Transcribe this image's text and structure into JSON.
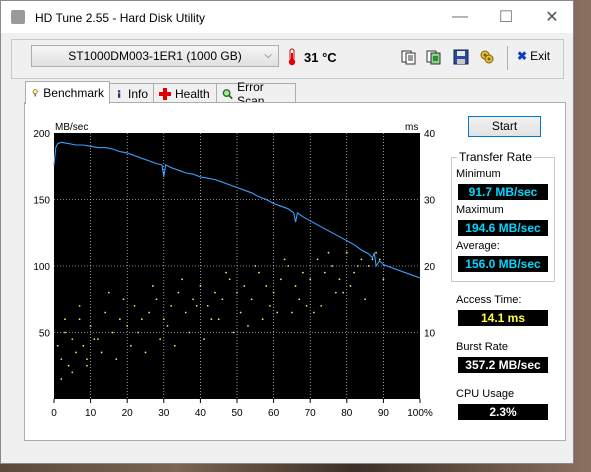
{
  "window": {
    "title": "HD Tune 2.55 - Hard Disk Utility"
  },
  "toolbar": {
    "drive": "ST1000DM003-1ER1 (1000 GB)",
    "temperature": "31 °C",
    "exit_label": "Exit",
    "icons": [
      "copy-text-icon",
      "copy-image-icon",
      "save-icon",
      "options-icon"
    ]
  },
  "tabs": [
    {
      "label": "Benchmark",
      "icon": "benchmark-icon",
      "active": true
    },
    {
      "label": "Info",
      "icon": "info-icon",
      "active": false
    },
    {
      "label": "Health",
      "icon": "health-icon",
      "active": false
    },
    {
      "label": "Error Scan",
      "icon": "error-scan-icon",
      "active": false
    }
  ],
  "benchmark": {
    "start_label": "Start",
    "transfer_rate_title": "Transfer Rate",
    "minimum_label": "Minimum",
    "minimum_value": "91.7 MB/sec",
    "maximum_label": "Maximum",
    "maximum_value": "194.6 MB/sec",
    "average_label": "Average:",
    "average_value": "156.0 MB/sec",
    "access_time_label": "Access Time:",
    "access_time_value": "14.1 ms",
    "burst_rate_label": "Burst Rate",
    "burst_rate_value": "357.2 MB/sec",
    "cpu_usage_label": "CPU Usage",
    "cpu_usage_value": "2.3%"
  },
  "colors": {
    "transfer_line": "#3aa0ff",
    "access_dots": "#e8e870",
    "grid": "#ffffff",
    "plot_bg": "#000000"
  },
  "chart_data": {
    "type": "line",
    "ylabel_left": "MB/sec",
    "ylabel_right": "ms",
    "x_ticks": [
      "0",
      "10",
      "20",
      "30",
      "40",
      "50",
      "60",
      "70",
      "80",
      "90",
      "100%"
    ],
    "y_left_ticks": [
      "200",
      "150",
      "100",
      "50"
    ],
    "y_right_ticks": [
      "40",
      "30",
      "20",
      "10"
    ],
    "xlim": [
      0,
      100
    ],
    "ylim_left": [
      0,
      200
    ],
    "ylim_right": [
      0,
      40
    ],
    "grid": true,
    "series": [
      {
        "axis": "left",
        "x": [
          0,
          0.5,
          1,
          2,
          4,
          6,
          8,
          10,
          12,
          14,
          16,
          18,
          20,
          22,
          24,
          26,
          28,
          29.5,
          30,
          30.5,
          32,
          34,
          36,
          38,
          40,
          42,
          44,
          46,
          48,
          50,
          52,
          54,
          56,
          58,
          60,
          62,
          64,
          65.5,
          66,
          66.5,
          68,
          70,
          72,
          74,
          76,
          78,
          80,
          82,
          84,
          86,
          87,
          87.5,
          88,
          89,
          90,
          92,
          94,
          96,
          98,
          100
        ],
        "y": [
          176,
          189,
          192,
          193,
          192,
          191,
          191,
          190,
          189,
          189,
          188,
          186,
          185,
          183,
          181,
          179,
          177,
          176,
          167,
          176,
          174,
          172,
          170,
          169,
          167,
          166,
          165,
          163,
          161,
          159,
          157,
          155,
          152,
          150,
          147,
          145,
          143,
          140,
          133,
          140,
          137,
          134,
          131,
          128,
          125,
          122,
          119,
          116,
          112,
          109,
          106,
          110,
          100,
          104,
          101,
          99,
          97,
          95,
          93,
          91
        ]
      },
      {
        "axis": "right",
        "x": [
          1,
          2,
          3,
          4,
          5,
          6,
          7,
          8,
          9,
          10,
          12,
          14,
          16,
          18,
          20,
          22,
          24,
          26,
          28,
          30,
          32,
          34,
          36,
          38,
          40,
          42,
          44,
          46,
          48,
          50,
          52,
          54,
          56,
          58,
          60,
          62,
          64,
          66,
          68,
          70,
          72,
          74,
          76,
          78,
          80,
          82,
          84,
          86,
          88,
          90,
          3,
          7,
          11,
          15,
          19,
          23,
          27,
          31,
          35,
          39,
          43,
          47,
          51,
          55,
          59,
          63,
          67,
          71,
          75,
          79,
          83,
          87,
          5,
          13,
          21,
          29,
          37,
          45,
          53,
          61,
          69,
          77,
          85,
          2,
          9,
          17,
          25,
          33,
          41,
          49,
          57,
          65,
          73,
          81,
          89
        ],
        "y": [
          8,
          6,
          10,
          5,
          9,
          7,
          12,
          8,
          6,
          11,
          9,
          13,
          10,
          12,
          11,
          14,
          12,
          13,
          15,
          12,
          14,
          16,
          13,
          15,
          17,
          14,
          16,
          15,
          18,
          16,
          17,
          15,
          19,
          17,
          16,
          18,
          20,
          17,
          19,
          18,
          21,
          19,
          20,
          18,
          22,
          19,
          21,
          20,
          22,
          18,
          12,
          14,
          9,
          16,
          15,
          10,
          17,
          11,
          18,
          14,
          12,
          19,
          13,
          20,
          14,
          21,
          15,
          13,
          22,
          16,
          20,
          21,
          4,
          7,
          8,
          9,
          10,
          12,
          11,
          13,
          14,
          16,
          15,
          3,
          5,
          6,
          7,
          8,
          9,
          10,
          12,
          13,
          14,
          17,
          21
        ]
      }
    ]
  }
}
